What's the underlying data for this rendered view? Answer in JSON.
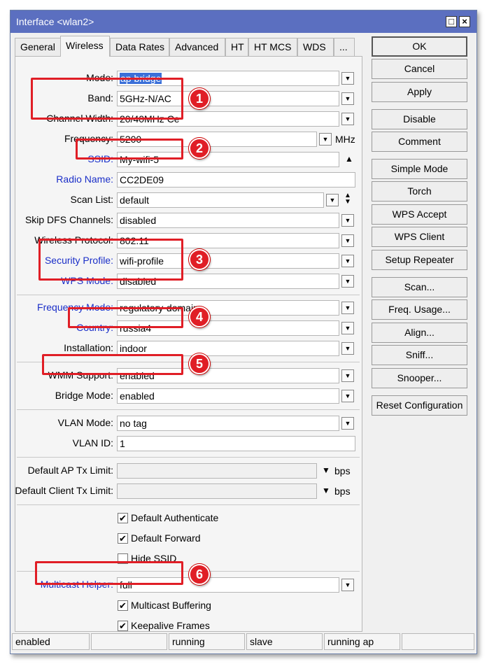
{
  "window": {
    "title": "Interface <wlan2>"
  },
  "tabs": [
    "General",
    "Wireless",
    "Data Rates",
    "Advanced",
    "HT",
    "HT MCS",
    "WDS",
    "..."
  ],
  "fields": {
    "mode": {
      "label": "Mode:",
      "value": "ap bridge"
    },
    "band": {
      "label": "Band:",
      "value": "5GHz-N/AC"
    },
    "channel_width": {
      "label": "Channel Width:",
      "value": "20/40MHz Ce"
    },
    "frequency": {
      "label": "Frequency:",
      "value": "5200",
      "unit": "MHz"
    },
    "ssid": {
      "label": "SSID:",
      "value": "My-wifi-5"
    },
    "radio_name": {
      "label": "Radio Name:",
      "value": "CC2DE09"
    },
    "scan_list": {
      "label": "Scan List:",
      "value": "default"
    },
    "skip_dfs": {
      "label": "Skip DFS Channels:",
      "value": "disabled"
    },
    "wireless_protocol": {
      "label": "Wireless Protocol:",
      "value": "802.11"
    },
    "security_profile": {
      "label": "Security Profile:",
      "value": "wifi-profile"
    },
    "wps_mode": {
      "label": "WPS Mode:",
      "value": "disabled"
    },
    "frequency_mode": {
      "label": "Frequency Mode:",
      "value": "regulatory-domain"
    },
    "country": {
      "label": "Country:",
      "value": "russia4"
    },
    "installation": {
      "label": "Installation:",
      "value": "indoor"
    },
    "wmm_support": {
      "label": "WMM Support:",
      "value": "enabled"
    },
    "bridge_mode": {
      "label": "Bridge Mode:",
      "value": "enabled"
    },
    "vlan_mode": {
      "label": "VLAN Mode:",
      "value": "no tag"
    },
    "vlan_id": {
      "label": "VLAN ID:",
      "value": "1"
    },
    "default_ap_tx": {
      "label": "Default AP Tx Limit:",
      "value": "",
      "unit": "bps"
    },
    "default_client_tx": {
      "label": "Default Client Tx Limit:",
      "value": "",
      "unit": "bps"
    },
    "multicast_helper": {
      "label": "Multicast Helper:",
      "value": "full"
    }
  },
  "checkboxes": {
    "default_authenticate": {
      "label": "Default Authenticate",
      "checked": true
    },
    "default_forward": {
      "label": "Default Forward",
      "checked": true
    },
    "hide_ssid": {
      "label": "Hide SSID",
      "checked": false
    },
    "multicast_buffering": {
      "label": "Multicast Buffering",
      "checked": true
    },
    "keepalive_frames": {
      "label": "Keepalive Frames",
      "checked": true
    }
  },
  "buttons": {
    "ok": "OK",
    "cancel": "Cancel",
    "apply": "Apply",
    "disable": "Disable",
    "comment": "Comment",
    "simple_mode": "Simple Mode",
    "torch": "Torch",
    "wps_accept": "WPS Accept",
    "wps_client": "WPS Client",
    "setup_repeater": "Setup Repeater",
    "scan": "Scan...",
    "freq_usage": "Freq. Usage...",
    "align": "Align...",
    "sniff": "Sniff...",
    "snooper": "Snooper...",
    "reset_configuration": "Reset Configuration"
  },
  "status": [
    "enabled",
    "",
    "running",
    "slave",
    "running ap",
    ""
  ],
  "annotations": [
    "1",
    "2",
    "3",
    "4",
    "5",
    "6"
  ],
  "colors": {
    "titlebar": "#5b6fc0",
    "highlight": "#e01e26",
    "blue_label": "#1a2ec8"
  }
}
